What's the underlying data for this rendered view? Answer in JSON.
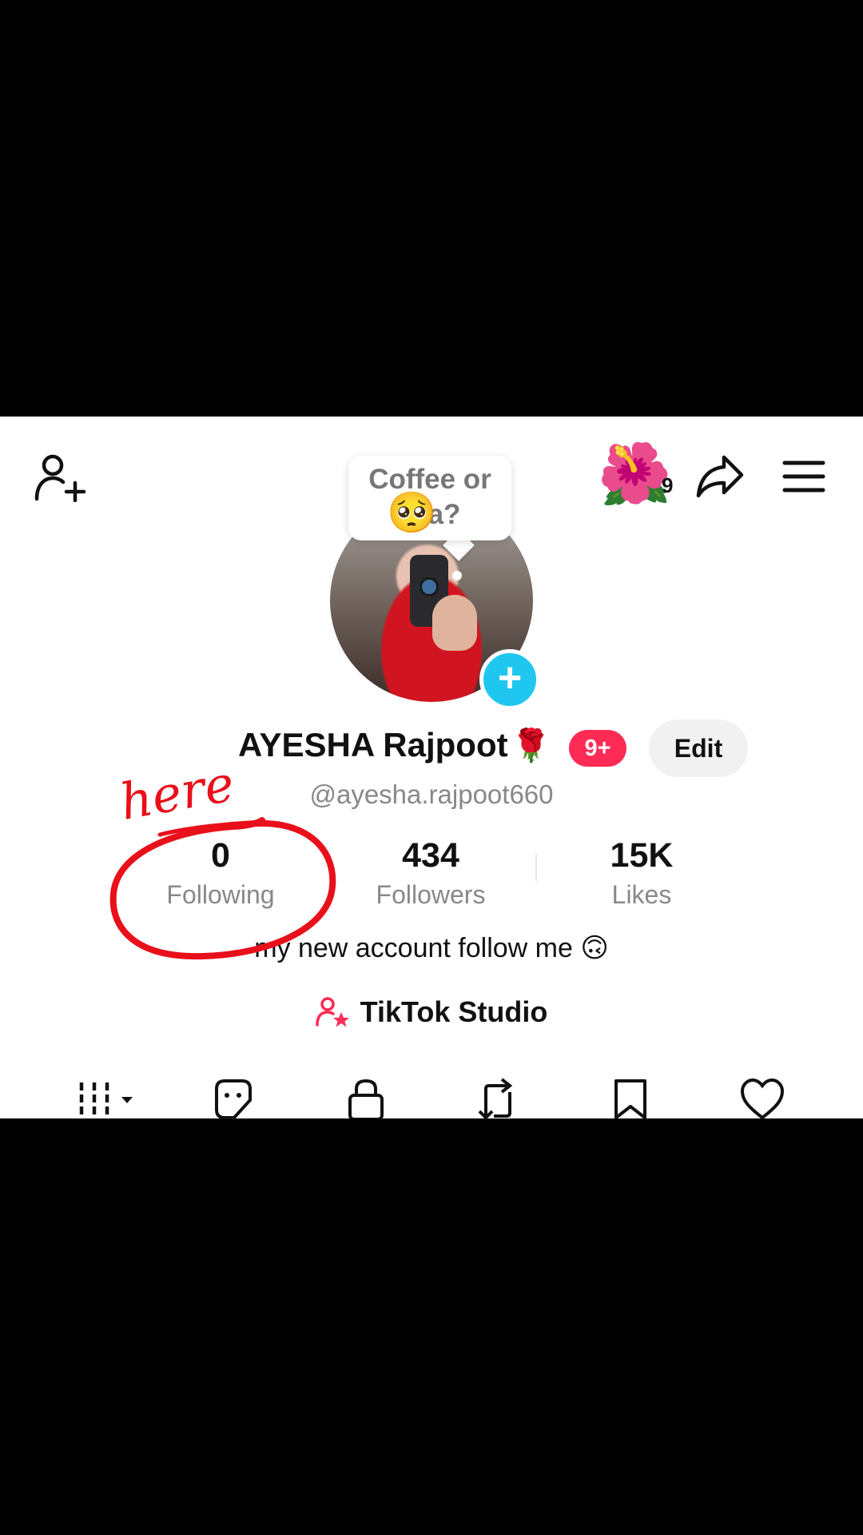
{
  "header": {
    "add_friend_icon": "person-plus-icon",
    "flower_emoji": "🌺",
    "flower_count": "9",
    "share_icon": "share-arrow-icon",
    "menu_icon": "hamburger-menu-icon"
  },
  "note_bubble": {
    "line1": "Coffee or",
    "line2": "a?",
    "emoji": "🥺"
  },
  "profile": {
    "display_name": "AYESHA Rajpoot",
    "name_emoji": "🌹",
    "notification_badge": "9+",
    "edit_label": "Edit",
    "username": "@ayesha.rajpoot660"
  },
  "stats": [
    {
      "value": "0",
      "label": "Following"
    },
    {
      "value": "434",
      "label": "Followers"
    },
    {
      "value": "15K",
      "label": "Likes"
    }
  ],
  "bio": "my new account follow me 🙃",
  "studio": {
    "label": "TikTok Studio",
    "icon": "person-star-icon"
  },
  "tabs": [
    "videos-grid-icon",
    "sticker-icon",
    "lock-icon",
    "repost-icon",
    "bookmark-icon",
    "heart-icon"
  ],
  "annotation": {
    "text": "here",
    "color": "#e8101a"
  },
  "colors": {
    "accent_red": "#fe2c55",
    "plus_blue": "#1fc7f0"
  }
}
